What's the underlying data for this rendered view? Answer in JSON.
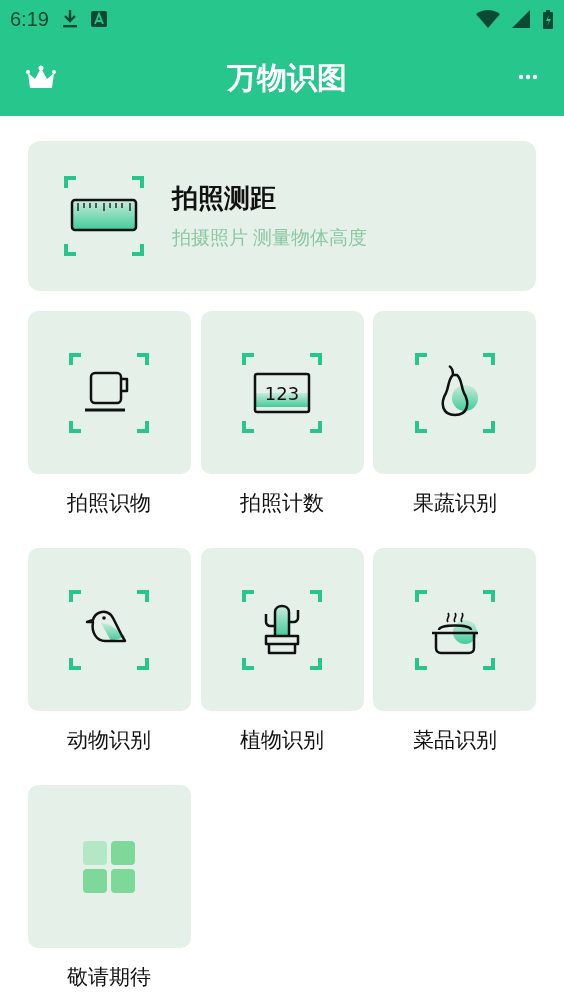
{
  "status_bar": {
    "time": "6:19"
  },
  "app_bar": {
    "title": "万物识图"
  },
  "hero": {
    "title": "拍照测距",
    "subtitle": "拍摄照片 测量物体高度",
    "kind": "ruler"
  },
  "tiles": [
    {
      "label": "拍照识物",
      "kind": "cup"
    },
    {
      "label": "拍照计数",
      "kind": "counter",
      "icon_text": "123"
    },
    {
      "label": "果蔬识别",
      "kind": "pear"
    },
    {
      "label": "动物识别",
      "kind": "bird"
    },
    {
      "label": "植物识别",
      "kind": "cactus"
    },
    {
      "label": "菜品识别",
      "kind": "pot"
    },
    {
      "label": "敬请期待",
      "kind": "grid"
    }
  ]
}
